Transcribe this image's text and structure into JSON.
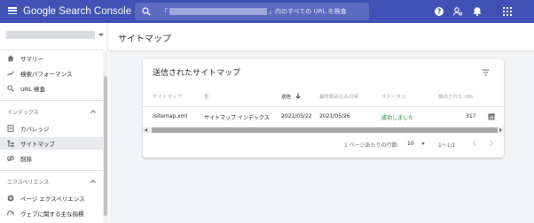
{
  "app": {
    "title": "Google Search Console",
    "search_placeholder_prefix": "「",
    "search_placeholder_suffix": "」内のすべての URL を検査"
  },
  "sidebar": {
    "items": [
      {
        "label": "サマリー",
        "icon": "home-icon"
      },
      {
        "label": "検索パフォーマンス",
        "icon": "trending-up-icon"
      },
      {
        "label": "URL 検査",
        "icon": "search-icon"
      }
    ],
    "index_section": {
      "heading": "インデックス",
      "items": [
        {
          "label": "カバレッジ",
          "icon": "coverage-icon"
        },
        {
          "label": "サイトマップ",
          "icon": "sitemap-icon",
          "active": true
        },
        {
          "label": "削除",
          "icon": "removals-icon"
        }
      ]
    },
    "experience_section": {
      "heading": "エクスペリエンス",
      "items": [
        {
          "label": "ページ エクスペリエンス",
          "icon": "page-experience-icon"
        },
        {
          "label": "ウェブに関する主な指標",
          "icon": "speed-icon"
        }
      ]
    }
  },
  "page": {
    "title": "サイトマップ"
  },
  "card": {
    "title": "送信されたサイトマップ",
    "columns": [
      "サイトマップ",
      "型",
      "送信",
      "最終読み込み日時",
      "ステータス",
      "検出された URL"
    ],
    "sort_column_index": 2,
    "rows": [
      {
        "sitemap": "/sitemap.xml",
        "type": "サイトマップ インデックス",
        "submitted": "2021/03/22",
        "last_read": "2021/05/26",
        "status": "成功しました",
        "discovered_urls": "317"
      }
    ],
    "pagination": {
      "rows_per_page_label": "1 ページあたりの行数:",
      "rows_per_page": "10",
      "range": "1〜1/1"
    }
  },
  "colors": {
    "topbar": "#3f51b5",
    "search_bg": "#5c6bc0",
    "status_success": "#188038",
    "active_nav": "#e8eaed",
    "main_bg": "#f1f3f4"
  }
}
